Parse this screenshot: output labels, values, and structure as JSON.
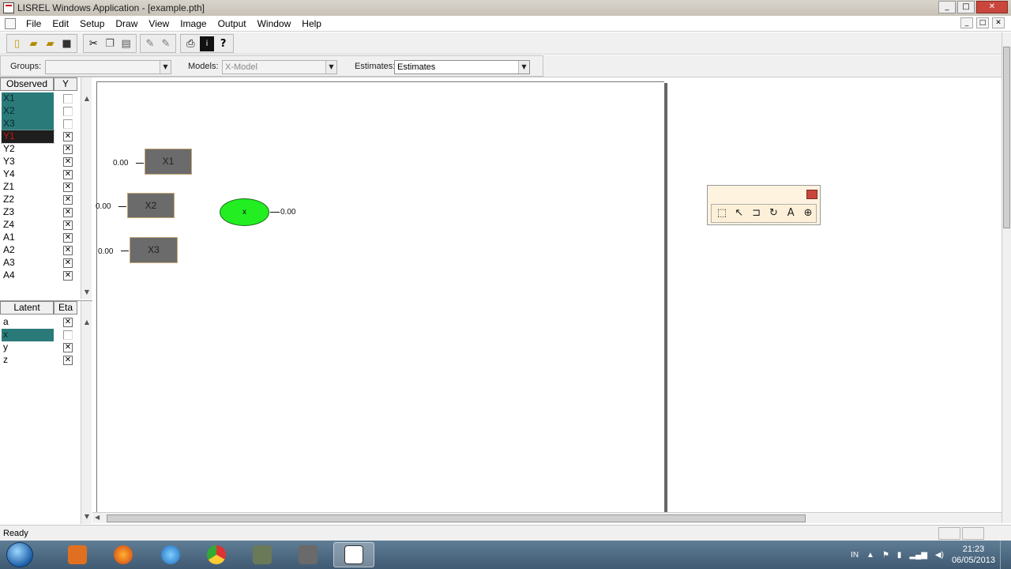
{
  "window": {
    "title": "LISREL Windows Application - [example.pth]",
    "minimize": "_",
    "maximize": "□",
    "close": "✕"
  },
  "menu": {
    "items": [
      "File",
      "Edit",
      "Setup",
      "Draw",
      "View",
      "Image",
      "Output",
      "Window",
      "Help"
    ]
  },
  "toolbar": {
    "icons": [
      "new-icon",
      "open-icon",
      "open-folder-icon",
      "save-icon",
      "cut-icon",
      "copy-icon",
      "paste-icon",
      "draw-icon",
      "draw-alt-icon",
      "print-icon",
      "info-icon",
      "help-icon"
    ]
  },
  "options": {
    "groups_label": "Groups:",
    "groups_value": "",
    "models_label": "Models:",
    "models_value": "X-Model",
    "estimates_label": "Estimates:",
    "estimates_value": "Estimates"
  },
  "observed": {
    "header_name": "Observed",
    "header_flag": "Y",
    "vars": [
      {
        "name": "X1",
        "checked": false,
        "state": "sel"
      },
      {
        "name": "X2",
        "checked": false,
        "state": "sel"
      },
      {
        "name": "X3",
        "checked": false,
        "state": "sel"
      },
      {
        "name": "Y1",
        "checked": true,
        "state": "selred"
      },
      {
        "name": "Y2",
        "checked": true,
        "state": ""
      },
      {
        "name": "Y3",
        "checked": true,
        "state": ""
      },
      {
        "name": "Y4",
        "checked": true,
        "state": ""
      },
      {
        "name": "Z1",
        "checked": true,
        "state": ""
      },
      {
        "name": "Z2",
        "checked": true,
        "state": ""
      },
      {
        "name": "Z3",
        "checked": true,
        "state": ""
      },
      {
        "name": "Z4",
        "checked": true,
        "state": ""
      },
      {
        "name": "A1",
        "checked": true,
        "state": ""
      },
      {
        "name": "A2",
        "checked": true,
        "state": ""
      },
      {
        "name": "A3",
        "checked": true,
        "state": ""
      },
      {
        "name": "A4",
        "checked": true,
        "state": ""
      }
    ]
  },
  "latent": {
    "header_name": "Latent",
    "header_flag": "Eta",
    "vars": [
      {
        "name": "a",
        "checked": true,
        "state": ""
      },
      {
        "name": "x",
        "checked": false,
        "state": "sel"
      },
      {
        "name": "y",
        "checked": true,
        "state": ""
      },
      {
        "name": "z",
        "checked": true,
        "state": ""
      }
    ]
  },
  "diagram": {
    "boxes": [
      {
        "label": "X1",
        "error": "0.00"
      },
      {
        "label": "X2",
        "error": "0.00"
      },
      {
        "label": "X3",
        "error": "0.00"
      }
    ],
    "latent": {
      "label": "x",
      "error": "0.00"
    },
    "colors": {
      "box": "#6b6b6b",
      "latent": "#22ee22"
    }
  },
  "palette": {
    "tools": [
      "select-icon",
      "arrow-icon",
      "curve-icon",
      "rotate-icon",
      "text-icon",
      "zoom-icon"
    ]
  },
  "status": {
    "text": "Ready"
  },
  "taskbar": {
    "tray_lang": "IN",
    "time": "21:23",
    "date": "06/05/2013"
  }
}
